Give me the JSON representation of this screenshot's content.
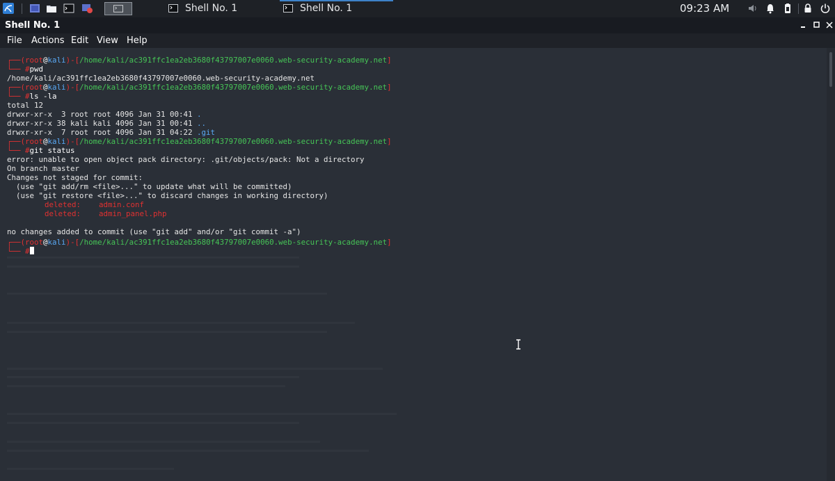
{
  "taskbar": {
    "tasks": [
      {
        "label": "Shell No. 1"
      },
      {
        "label": "Shell No. 1"
      }
    ],
    "clock": "09:23 AM"
  },
  "window": {
    "title": "Shell No. 1",
    "menu": [
      "File",
      "Actions",
      "Edit",
      "View",
      "Help"
    ]
  },
  "prompt": {
    "open": "┌──(",
    "user": "root",
    "at": "@",
    "host": "kali",
    "mid": ")-[",
    "path": "/home/kali/ac391ffc1ea2eb3680f43797007e0060.web-security-academy.net",
    "close": "]",
    "arrow": "└─",
    "hash": "#"
  },
  "session": {
    "cmd_pwd": "pwd",
    "pwd_output": "/home/kali/ac391ffc1ea2eb3680f43797007e0060.web-security-academy.net",
    "cmd_ls": "ls -la",
    "ls_total": "total 12",
    "ls_rows": [
      {
        "meta": "drwxr-xr-x  3 root root 4096 Jan 31 00:41 ",
        "name": "."
      },
      {
        "meta": "drwxr-xr-x 38 kali kali 4096 Jan 31 00:41 ",
        "name": ".."
      },
      {
        "meta": "drwxr-xr-x  7 root root 4096 Jan 31 04:22 ",
        "name": ".git"
      }
    ],
    "cmd_status": "git status",
    "status_lines": [
      "error: unable to open object pack directory: .git/objects/pack: Not a directory",
      "On branch master",
      "Changes not staged for commit:",
      "  (use \"git add/rm <file>...\" to update what will be committed)",
      "  (use \"git restore <file>...\" to discard changes in working directory)"
    ],
    "deleted": [
      {
        "label": "deleted:",
        "file": "admin.conf"
      },
      {
        "label": "deleted:",
        "file": "admin_panel.php"
      }
    ],
    "no_changes": "no changes added to commit (use \"git add\" and/or \"git commit -a\")"
  }
}
